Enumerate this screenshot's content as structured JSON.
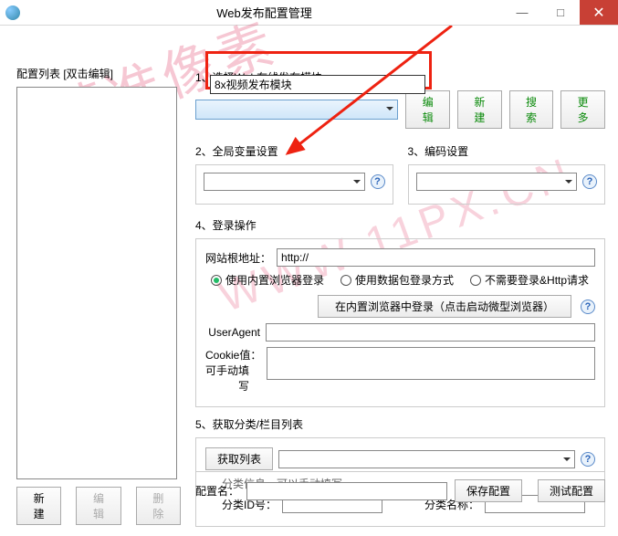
{
  "window": {
    "title": "Web发布配置管理",
    "min": "—",
    "max": "□",
    "close": "✕"
  },
  "left": {
    "header": "配置列表   [双击编辑]",
    "new": "新建",
    "edit": "编辑",
    "delete": "删除"
  },
  "sec1": {
    "title": "1、选择Web在线发布模块",
    "dropdown_item": "8x视频发布模块",
    "btn_edit": "编辑",
    "btn_new": "新建",
    "btn_search": "搜索",
    "btn_more": "更多"
  },
  "sec2": {
    "title": "2、全局变量设置"
  },
  "sec3": {
    "title": "3、编码设置"
  },
  "sec4": {
    "title": "4、登录操作",
    "root_label": "网站根地址：",
    "root_value": "http://",
    "r1": "使用内置浏览器登录",
    "r2": "使用数据包登录方式",
    "r3": "不需要登录&Http请求",
    "login_btn": "在内置浏览器中登录（点击启动微型浏览器）",
    "ua_label": "UserAgent",
    "cookie_label": "Cookie值：",
    "manual_label": "可手动填写"
  },
  "sec5": {
    "title": "5、获取分类/栏目列表",
    "get_list": "获取列表",
    "hint": "分类信息，可以手动填写",
    "id_label": "分类ID号：",
    "name_label": "分类名称："
  },
  "footer": {
    "cfg_label": "配置名：",
    "save": "保存配置",
    "test": "测试配置"
  },
  "help": "?"
}
